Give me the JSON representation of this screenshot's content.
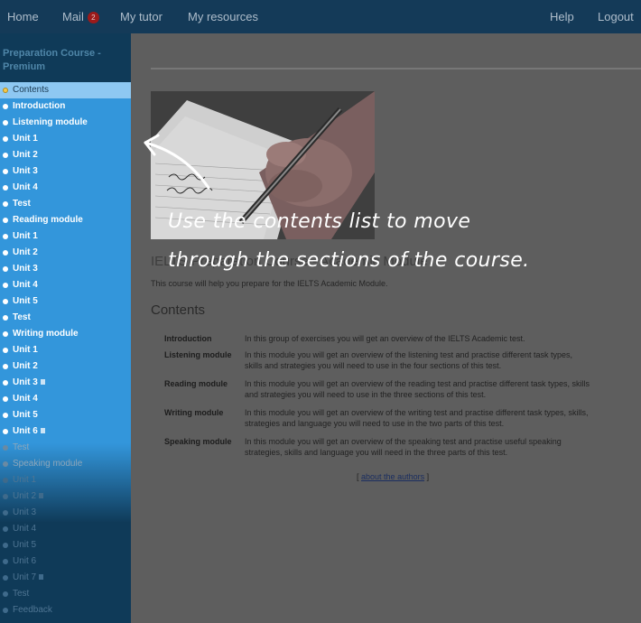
{
  "nav": {
    "left": [
      {
        "label": "Home"
      },
      {
        "label": "Mail",
        "badge": "2"
      },
      {
        "label": "My tutor"
      },
      {
        "label": "My resources"
      }
    ],
    "right": [
      {
        "label": "Help"
      },
      {
        "label": "Logout"
      }
    ]
  },
  "sidebar": {
    "course_title": "Preparation Course - Premium",
    "items": [
      {
        "label": "Contents",
        "state": "active"
      },
      {
        "label": "Introduction",
        "state": "normal"
      },
      {
        "label": "Listening module",
        "state": "normal"
      },
      {
        "label": "Unit 1",
        "state": "normal"
      },
      {
        "label": "Unit 2",
        "state": "normal"
      },
      {
        "label": "Unit 3",
        "state": "normal"
      },
      {
        "label": "Unit 4",
        "state": "normal"
      },
      {
        "label": "Test",
        "state": "normal"
      },
      {
        "label": "Reading module",
        "state": "normal"
      },
      {
        "label": "Unit 1",
        "state": "normal"
      },
      {
        "label": "Unit 2",
        "state": "normal"
      },
      {
        "label": "Unit 3",
        "state": "normal"
      },
      {
        "label": "Unit 4",
        "state": "normal"
      },
      {
        "label": "Unit 5",
        "state": "normal"
      },
      {
        "label": "Test",
        "state": "normal"
      },
      {
        "label": "Writing module",
        "state": "normal"
      },
      {
        "label": "Unit 1",
        "state": "normal"
      },
      {
        "label": "Unit 2",
        "state": "normal"
      },
      {
        "label": "Unit 3",
        "state": "normal",
        "flag": true
      },
      {
        "label": "Unit 4",
        "state": "normal"
      },
      {
        "label": "Unit 5",
        "state": "normal"
      },
      {
        "label": "Unit 6",
        "state": "normal",
        "flag": true
      },
      {
        "label": "Test",
        "state": "dim"
      },
      {
        "label": "Speaking module",
        "state": "dim"
      },
      {
        "label": "Unit 1",
        "state": "faint"
      },
      {
        "label": "Unit 2",
        "state": "faint",
        "flag": true
      },
      {
        "label": "Unit 3",
        "state": "faint"
      },
      {
        "label": "Unit 4",
        "state": "faint"
      },
      {
        "label": "Unit 5",
        "state": "faint"
      },
      {
        "label": "Unit 6",
        "state": "faint"
      },
      {
        "label": "Unit 7",
        "state": "faint",
        "flag": true
      },
      {
        "label": "Test",
        "state": "faint"
      },
      {
        "label": "Feedback",
        "state": "faint"
      }
    ]
  },
  "main": {
    "page_title": "IELTS Preparation Course - Academic Module",
    "intro": "This course will help you prepare for the IELTS Academic Module.",
    "contents_heading": "Contents",
    "modules": [
      {
        "name": "Introduction",
        "lines": [
          "In this group of exercises you will get an overview of the IELTS Academic test."
        ]
      },
      {
        "name": "Listening module",
        "lines": [
          "In this module you will get an overview of the listening test and practise different task types,",
          "skills and strategies you will need to use in the four sections of this test."
        ]
      },
      {
        "name": "Reading module",
        "lines": [
          "In this module you will get an overview of the reading test and practise different task types, skills",
          "and strategies you will need to use in the three sections of this test."
        ]
      },
      {
        "name": "Writing module",
        "lines": [
          "In this module you will get an overview of the writing test and practise different task types, skills,",
          "strategies and language you will need to use in the two parts of this test."
        ]
      },
      {
        "name": "Speaking module",
        "lines": [
          "In this module you will get an overview of the speaking test and practise useful speaking",
          "strategies, skills and language you will need in the three parts of this test."
        ]
      }
    ],
    "authors_open": "[",
    "authors_link": "about the authors",
    "authors_close": "]"
  },
  "overlay": {
    "lines": [
      "Use the contents list to move",
      "through the sections of the course."
    ]
  },
  "colors": {
    "nav_bg": "#143a58",
    "sidebar_bg": "#0f3a58",
    "toc_highlight": "#3396db",
    "active_item": "#8ec8f2",
    "mail_badge": "#9c1a1a"
  },
  "icons": {
    "toc_bullet": "bullet-dot-icon",
    "toc_flag": "flag-icon",
    "callout_arrow": "curved-arrow-icon"
  }
}
